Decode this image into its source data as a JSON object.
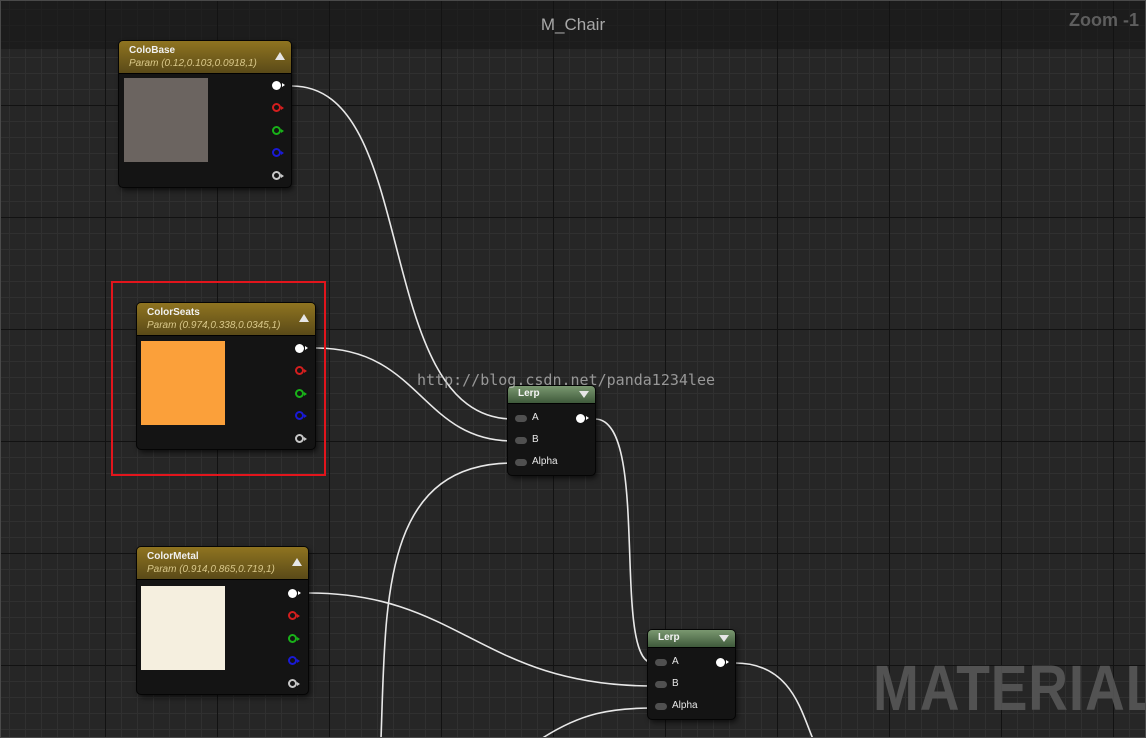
{
  "editor": {
    "title": "M_Chair",
    "zoom_label": "Zoom -1",
    "watermark": "MATERIAL",
    "overlay_url": "http://blog.csdn.net/panda1234lee"
  },
  "nodes": [
    {
      "name": "ColoBase",
      "subtitle": "Param (0.12,0.103,0.0918,1)",
      "swatch": "#6b6460"
    },
    {
      "name": "ColorSeats",
      "subtitle": "Param (0.974,0.338,0.0345,1)",
      "swatch": "#fba03a"
    },
    {
      "name": "ColorMetal",
      "subtitle": "Param (0.914,0.865,0.719,1)",
      "swatch": "#f5efdf"
    }
  ],
  "lerp_nodes": [
    {
      "title": "Lerp",
      "inputs": [
        "A",
        "B",
        "Alpha"
      ]
    },
    {
      "title": "Lerp",
      "inputs": [
        "A",
        "B",
        "Alpha"
      ]
    }
  ],
  "pin_colors": {
    "rgba": "#ffffff",
    "r": "#d41e1e",
    "g": "#19b219",
    "b": "#1a1ad6",
    "a": "#c8c8c8"
  },
  "wire_color": "#e8e8e8",
  "selection_color": "#e2151c",
  "header_color": "#8f7420",
  "lerp_header_color": "#7a9870"
}
